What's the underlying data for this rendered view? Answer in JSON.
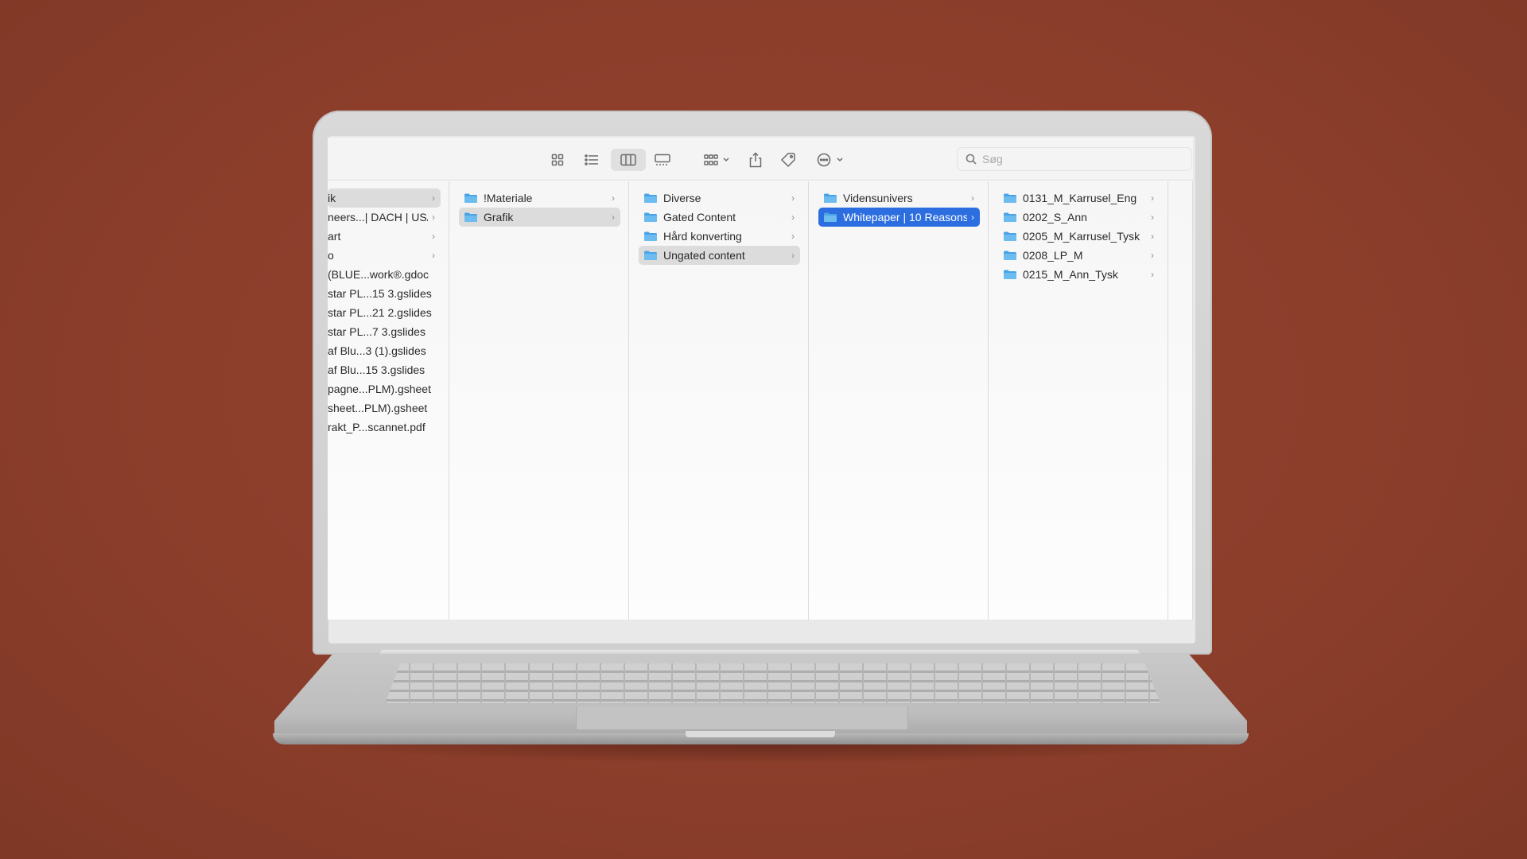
{
  "toolbar": {
    "view_icons": [
      "icon-view-icon",
      "list-view-icon",
      "column-view-icon",
      "gallery-view-icon"
    ],
    "active_view": "column-view-icon",
    "group_icon": "group-icon",
    "share_icon": "share-icon",
    "tag_icon": "tag-icon",
    "more_icon": "more-icon"
  },
  "search": {
    "placeholder": "Søg",
    "value": ""
  },
  "columns": [
    {
      "items": [
        {
          "label": "ik",
          "folder": false,
          "chevron": true,
          "selected": "grey"
        },
        {
          "label": "neers...| DACH | USA",
          "folder": false,
          "chevron": true
        },
        {
          "label": "art",
          "folder": false,
          "chevron": true
        },
        {
          "label": "o",
          "folder": false,
          "chevron": true
        },
        {
          "label": "(BLUE...work®.gdoc",
          "folder": false,
          "chevron": false
        },
        {
          "label": "star PL...15 3.gslides",
          "folder": false,
          "chevron": false
        },
        {
          "label": "star PL...21 2.gslides",
          "folder": false,
          "chevron": false
        },
        {
          "label": "star PL...7 3.gslides",
          "folder": false,
          "chevron": false
        },
        {
          "label": "af Blu...3 (1).gslides",
          "folder": false,
          "chevron": false
        },
        {
          "label": "af Blu...15 3.gslides",
          "folder": false,
          "chevron": false
        },
        {
          "label": "pagne...PLM).gsheet",
          "folder": false,
          "chevron": false
        },
        {
          "label": "sheet...PLM).gsheet",
          "folder": false,
          "chevron": false
        },
        {
          "label": "rakt_P...scannet.pdf",
          "folder": false,
          "chevron": false
        }
      ]
    },
    {
      "items": [
        {
          "label": "!Materiale",
          "folder": true,
          "chevron": true
        },
        {
          "label": "Grafik",
          "folder": true,
          "chevron": true,
          "selected": "grey"
        }
      ]
    },
    {
      "items": [
        {
          "label": "Diverse",
          "folder": true,
          "chevron": true
        },
        {
          "label": "Gated Content",
          "folder": true,
          "chevron": true
        },
        {
          "label": "Hård konverting",
          "folder": true,
          "chevron": true
        },
        {
          "label": "Ungated content",
          "folder": true,
          "chevron": true,
          "selected": "grey"
        }
      ]
    },
    {
      "items": [
        {
          "label": "Vidensunivers",
          "folder": true,
          "chevron": true
        },
        {
          "label": "Whitepaper | 10 Reasons",
          "folder": true,
          "chevron": true,
          "selected": "blue"
        }
      ]
    },
    {
      "items": [
        {
          "label": "0131_M_Karrusel_Eng",
          "folder": true,
          "chevron": true
        },
        {
          "label": "0202_S_Ann",
          "folder": true,
          "chevron": true
        },
        {
          "label": "0205_M_Karrusel_Tysk",
          "folder": true,
          "chevron": true
        },
        {
          "label": "0208_LP_M",
          "folder": true,
          "chevron": true
        },
        {
          "label": "0215_M_Ann_Tysk",
          "folder": true,
          "chevron": true
        }
      ]
    },
    {
      "items": []
    }
  ],
  "colors": {
    "background": "#8c3e2b",
    "selection_blue": "#2c6ee0",
    "selection_grey": "#dcdcdc",
    "folder_blue": "#5fb0e8"
  }
}
